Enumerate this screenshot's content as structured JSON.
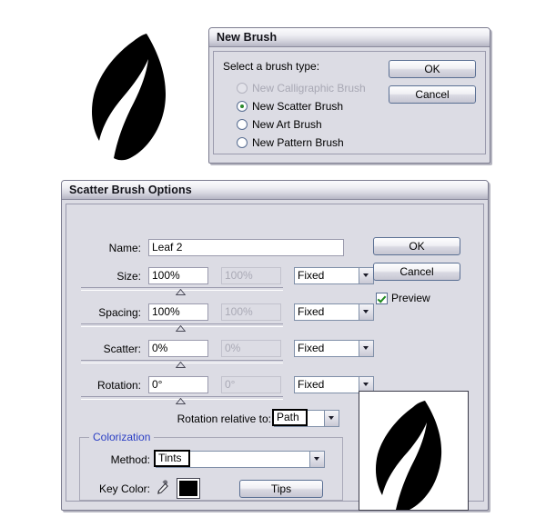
{
  "artwork": {
    "canvas_leaf_name": "leaf-shape",
    "fill_color": "#000000"
  },
  "new_brush_dialog": {
    "title": "New Brush",
    "prompt": "Select a brush type:",
    "options": [
      {
        "label": "New Calligraphic Brush",
        "selected": false,
        "disabled": true
      },
      {
        "label": "New Scatter Brush",
        "selected": true,
        "disabled": false
      },
      {
        "label": "New Art Brush",
        "selected": false,
        "disabled": false
      },
      {
        "label": "New Pattern Brush",
        "selected": false,
        "disabled": false
      }
    ],
    "ok_label": "OK",
    "cancel_label": "Cancel"
  },
  "scatter_dialog": {
    "title": "Scatter Brush Options",
    "name_label": "Name:",
    "name_value": "Leaf 2",
    "rows": [
      {
        "label": "Size:",
        "value": "100%",
        "secondary_value": "100%",
        "mode": "Fixed",
        "thumb_percent": 48
      },
      {
        "label": "Spacing:",
        "value": "100%",
        "secondary_value": "100%",
        "mode": "Fixed",
        "thumb_percent": 48
      },
      {
        "label": "Scatter:",
        "value": "0%",
        "secondary_value": "0%",
        "mode": "Fixed",
        "thumb_percent": 48
      },
      {
        "label": "Rotation:",
        "value": "0°",
        "secondary_value": "0°",
        "mode": "Fixed",
        "thumb_percent": 48
      }
    ],
    "rotation_relative_label": "Rotation relative to:",
    "rotation_relative_value": "Path",
    "colorization": {
      "legend": "Colorization",
      "legend_color": "#2b3fc4",
      "method_label": "Method:",
      "method_value": "Tints",
      "key_color_label": "Key Color:",
      "key_color_value": "#000000",
      "eyedropper_icon": "eyedropper-icon",
      "tips_label": "Tips"
    },
    "ok_label": "OK",
    "cancel_label": "Cancel",
    "preview_label": "Preview",
    "preview_checked": true
  }
}
